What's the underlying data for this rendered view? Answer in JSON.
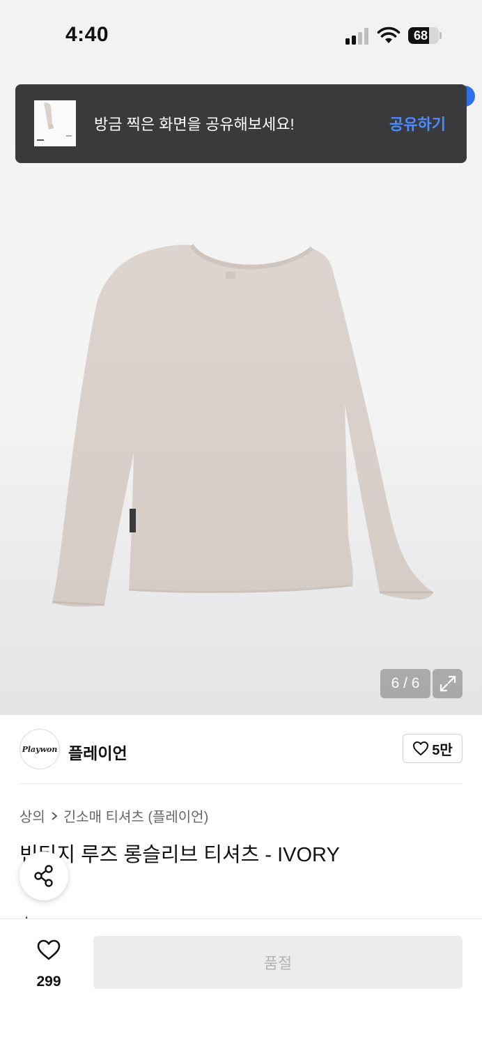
{
  "status_bar": {
    "time": "4:40",
    "battery": "68",
    "battery_level": 0.68
  },
  "toast": {
    "message": "방금 찍은 화면을 공유해보세요!",
    "action": "공유하기"
  },
  "gallery": {
    "counter": "6 / 6"
  },
  "brand": {
    "logo_text": "Playwon",
    "name": "플레이언",
    "like_count": "5만"
  },
  "breadcrumb": [
    "상의",
    "긴소매 티셔츠 (플레이언)"
  ],
  "product": {
    "title": "빈티지 루즈 롱슬리브 티셔츠 - IVORY"
  },
  "bottom_bar": {
    "wish_count": "299",
    "action_label": "품절"
  },
  "colors": {
    "accent": "#4b8cff",
    "toast_bg": "#3a3a3c",
    "soldout_bg": "#ececec"
  }
}
